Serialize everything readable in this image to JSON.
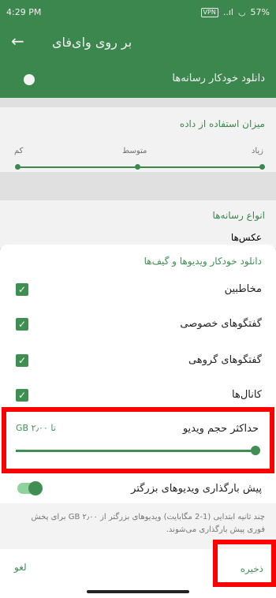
{
  "status_bar": {
    "time": "4:29 PM",
    "vpn": "VPN",
    "signal": "..ıl",
    "battery": "57%"
  },
  "app_bar": {
    "title": "بر روی وای‌فای"
  },
  "auto_download": {
    "label": "دانلود خودکار رسانه‌ها"
  },
  "data_usage": {
    "header": "میزان استفاده از داده",
    "levels": [
      "کم",
      "متوسط",
      "زیاد"
    ],
    "selected": "زیاد"
  },
  "media_types": {
    "header": "انواع رسانه‌ها",
    "first_item": "عکس‌ها"
  },
  "sheet": {
    "title": "دانلود خودکار ویدیوها و گیف‌ها",
    "items": [
      {
        "label": "مخاطبین",
        "checked": true
      },
      {
        "label": "گفتگوهای خصوصی",
        "checked": true
      },
      {
        "label": "گفتگوهای گروهی",
        "checked": true
      },
      {
        "label": "کانال‌ها",
        "checked": true
      }
    ],
    "max_video": {
      "label": "حداکثر حجم ویدیو",
      "value_text": "تا ۲٫۰۰ GB",
      "fraction": 1.0
    },
    "preload": {
      "label": "پیش بارگذاری ویدیوهای بزرگتر",
      "on": true
    },
    "info": "چند ثانیه ابتدایی (1-2 مگابایت) ویدیوهای بزرگتر از ۲٫۰۰ GB برای پخش فوری پیش بارگذاری می‌شوند.",
    "cancel_label": "لغو",
    "save_label": "ذخیره"
  },
  "colors": {
    "accent": "#3f8f52",
    "highlight": "#ff0000"
  }
}
